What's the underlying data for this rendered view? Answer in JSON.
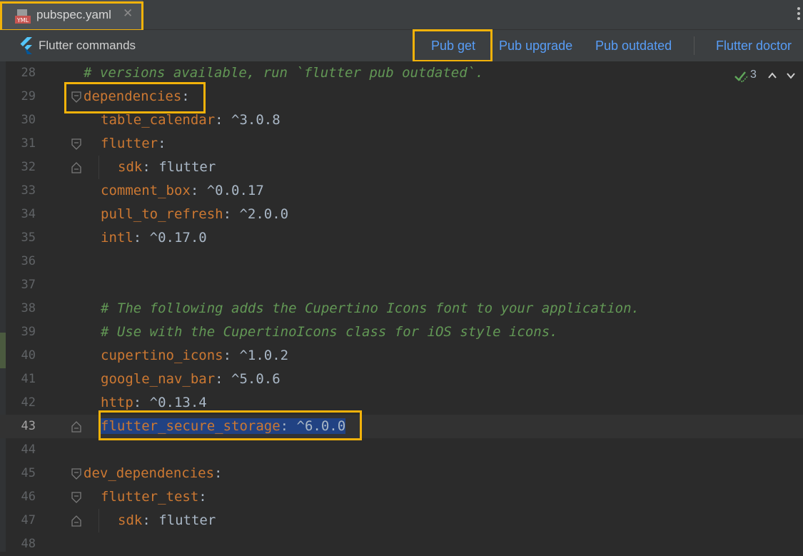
{
  "tab": {
    "label": "pubspec.yaml",
    "close": "✕",
    "icon": "yaml-file-icon"
  },
  "toolbar": {
    "title": "Flutter commands",
    "pub_get": "Pub get",
    "pub_upgrade": "Pub upgrade",
    "pub_outdated": "Pub outdated",
    "flutter_doctor": "Flutter doctor"
  },
  "inspections": {
    "count": "3"
  },
  "colors": {
    "highlight": "#f2b20a",
    "key": "#cc7832",
    "comment": "#629755",
    "text": "#a9b7c6",
    "link": "#589df6",
    "selection": "#214283"
  },
  "lines": [
    {
      "no": "28",
      "tokens": [
        {
          "t": "# versions available, run `flutter pub outdated`.",
          "c": "c"
        }
      ],
      "indent": 0,
      "fold": ""
    },
    {
      "no": "29",
      "tokens": [
        {
          "t": "dependencies",
          "c": "k"
        },
        {
          "t": ":",
          "c": ""
        }
      ],
      "indent": 0,
      "fold": "open"
    },
    {
      "no": "30",
      "tokens": [
        {
          "t": "table_calendar",
          "c": "k"
        },
        {
          "t": ": ^3.0.8",
          "c": ""
        }
      ],
      "indent": 1,
      "fold": ""
    },
    {
      "no": "31",
      "tokens": [
        {
          "t": "flutter",
          "c": "k"
        },
        {
          "t": ":",
          "c": ""
        }
      ],
      "indent": 1,
      "fold": "open"
    },
    {
      "no": "32",
      "tokens": [
        {
          "t": "sdk",
          "c": "k"
        },
        {
          "t": ": flutter",
          "c": ""
        }
      ],
      "indent": 2,
      "fold": "end"
    },
    {
      "no": "33",
      "tokens": [
        {
          "t": "comment_box",
          "c": "k"
        },
        {
          "t": ": ^0.0.17",
          "c": ""
        }
      ],
      "indent": 1,
      "fold": ""
    },
    {
      "no": "34",
      "tokens": [
        {
          "t": "pull_to_refresh",
          "c": "k"
        },
        {
          "t": ": ^2.0.0",
          "c": ""
        }
      ],
      "indent": 1,
      "fold": ""
    },
    {
      "no": "35",
      "tokens": [
        {
          "t": "intl",
          "c": "k"
        },
        {
          "t": ": ^0.17.0",
          "c": ""
        }
      ],
      "indent": 1,
      "fold": ""
    },
    {
      "no": "36",
      "tokens": [],
      "indent": 0,
      "fold": ""
    },
    {
      "no": "37",
      "tokens": [],
      "indent": 0,
      "fold": ""
    },
    {
      "no": "38",
      "tokens": [
        {
          "t": "# The following adds the Cupertino Icons font to your application.",
          "c": "c"
        }
      ],
      "indent": 1,
      "fold": ""
    },
    {
      "no": "39",
      "tokens": [
        {
          "t": "# Use with the CupertinoIcons class for iOS style icons.",
          "c": "c"
        }
      ],
      "indent": 1,
      "fold": ""
    },
    {
      "no": "40",
      "tokens": [
        {
          "t": "cupertino_icons",
          "c": "k"
        },
        {
          "t": ": ^1.0.2",
          "c": ""
        }
      ],
      "indent": 1,
      "fold": ""
    },
    {
      "no": "41",
      "tokens": [
        {
          "t": "google_nav_bar",
          "c": "k"
        },
        {
          "t": ": ^5.0.6",
          "c": ""
        }
      ],
      "indent": 1,
      "fold": ""
    },
    {
      "no": "42",
      "tokens": [
        {
          "t": "http",
          "c": "k"
        },
        {
          "t": ": ^0.13.4",
          "c": ""
        }
      ],
      "indent": 1,
      "fold": ""
    },
    {
      "no": "43",
      "tokens": [
        {
          "t": "flutter_secure_storage",
          "c": "k sel"
        },
        {
          "t": ": ^6.0.0",
          "c": "sel"
        }
      ],
      "indent": 1,
      "fold": "end",
      "current": true
    },
    {
      "no": "44",
      "tokens": [],
      "indent": 0,
      "fold": ""
    },
    {
      "no": "45",
      "tokens": [
        {
          "t": "dev_dependencies",
          "c": "k"
        },
        {
          "t": ":",
          "c": ""
        }
      ],
      "indent": 0,
      "fold": "open"
    },
    {
      "no": "46",
      "tokens": [
        {
          "t": "flutter_test",
          "c": "k"
        },
        {
          "t": ":",
          "c": ""
        }
      ],
      "indent": 1,
      "fold": "open"
    },
    {
      "no": "47",
      "tokens": [
        {
          "t": "sdk",
          "c": "k"
        },
        {
          "t": ": flutter",
          "c": ""
        }
      ],
      "indent": 2,
      "fold": "end"
    },
    {
      "no": "48",
      "tokens": [],
      "indent": 0,
      "fold": ""
    }
  ]
}
